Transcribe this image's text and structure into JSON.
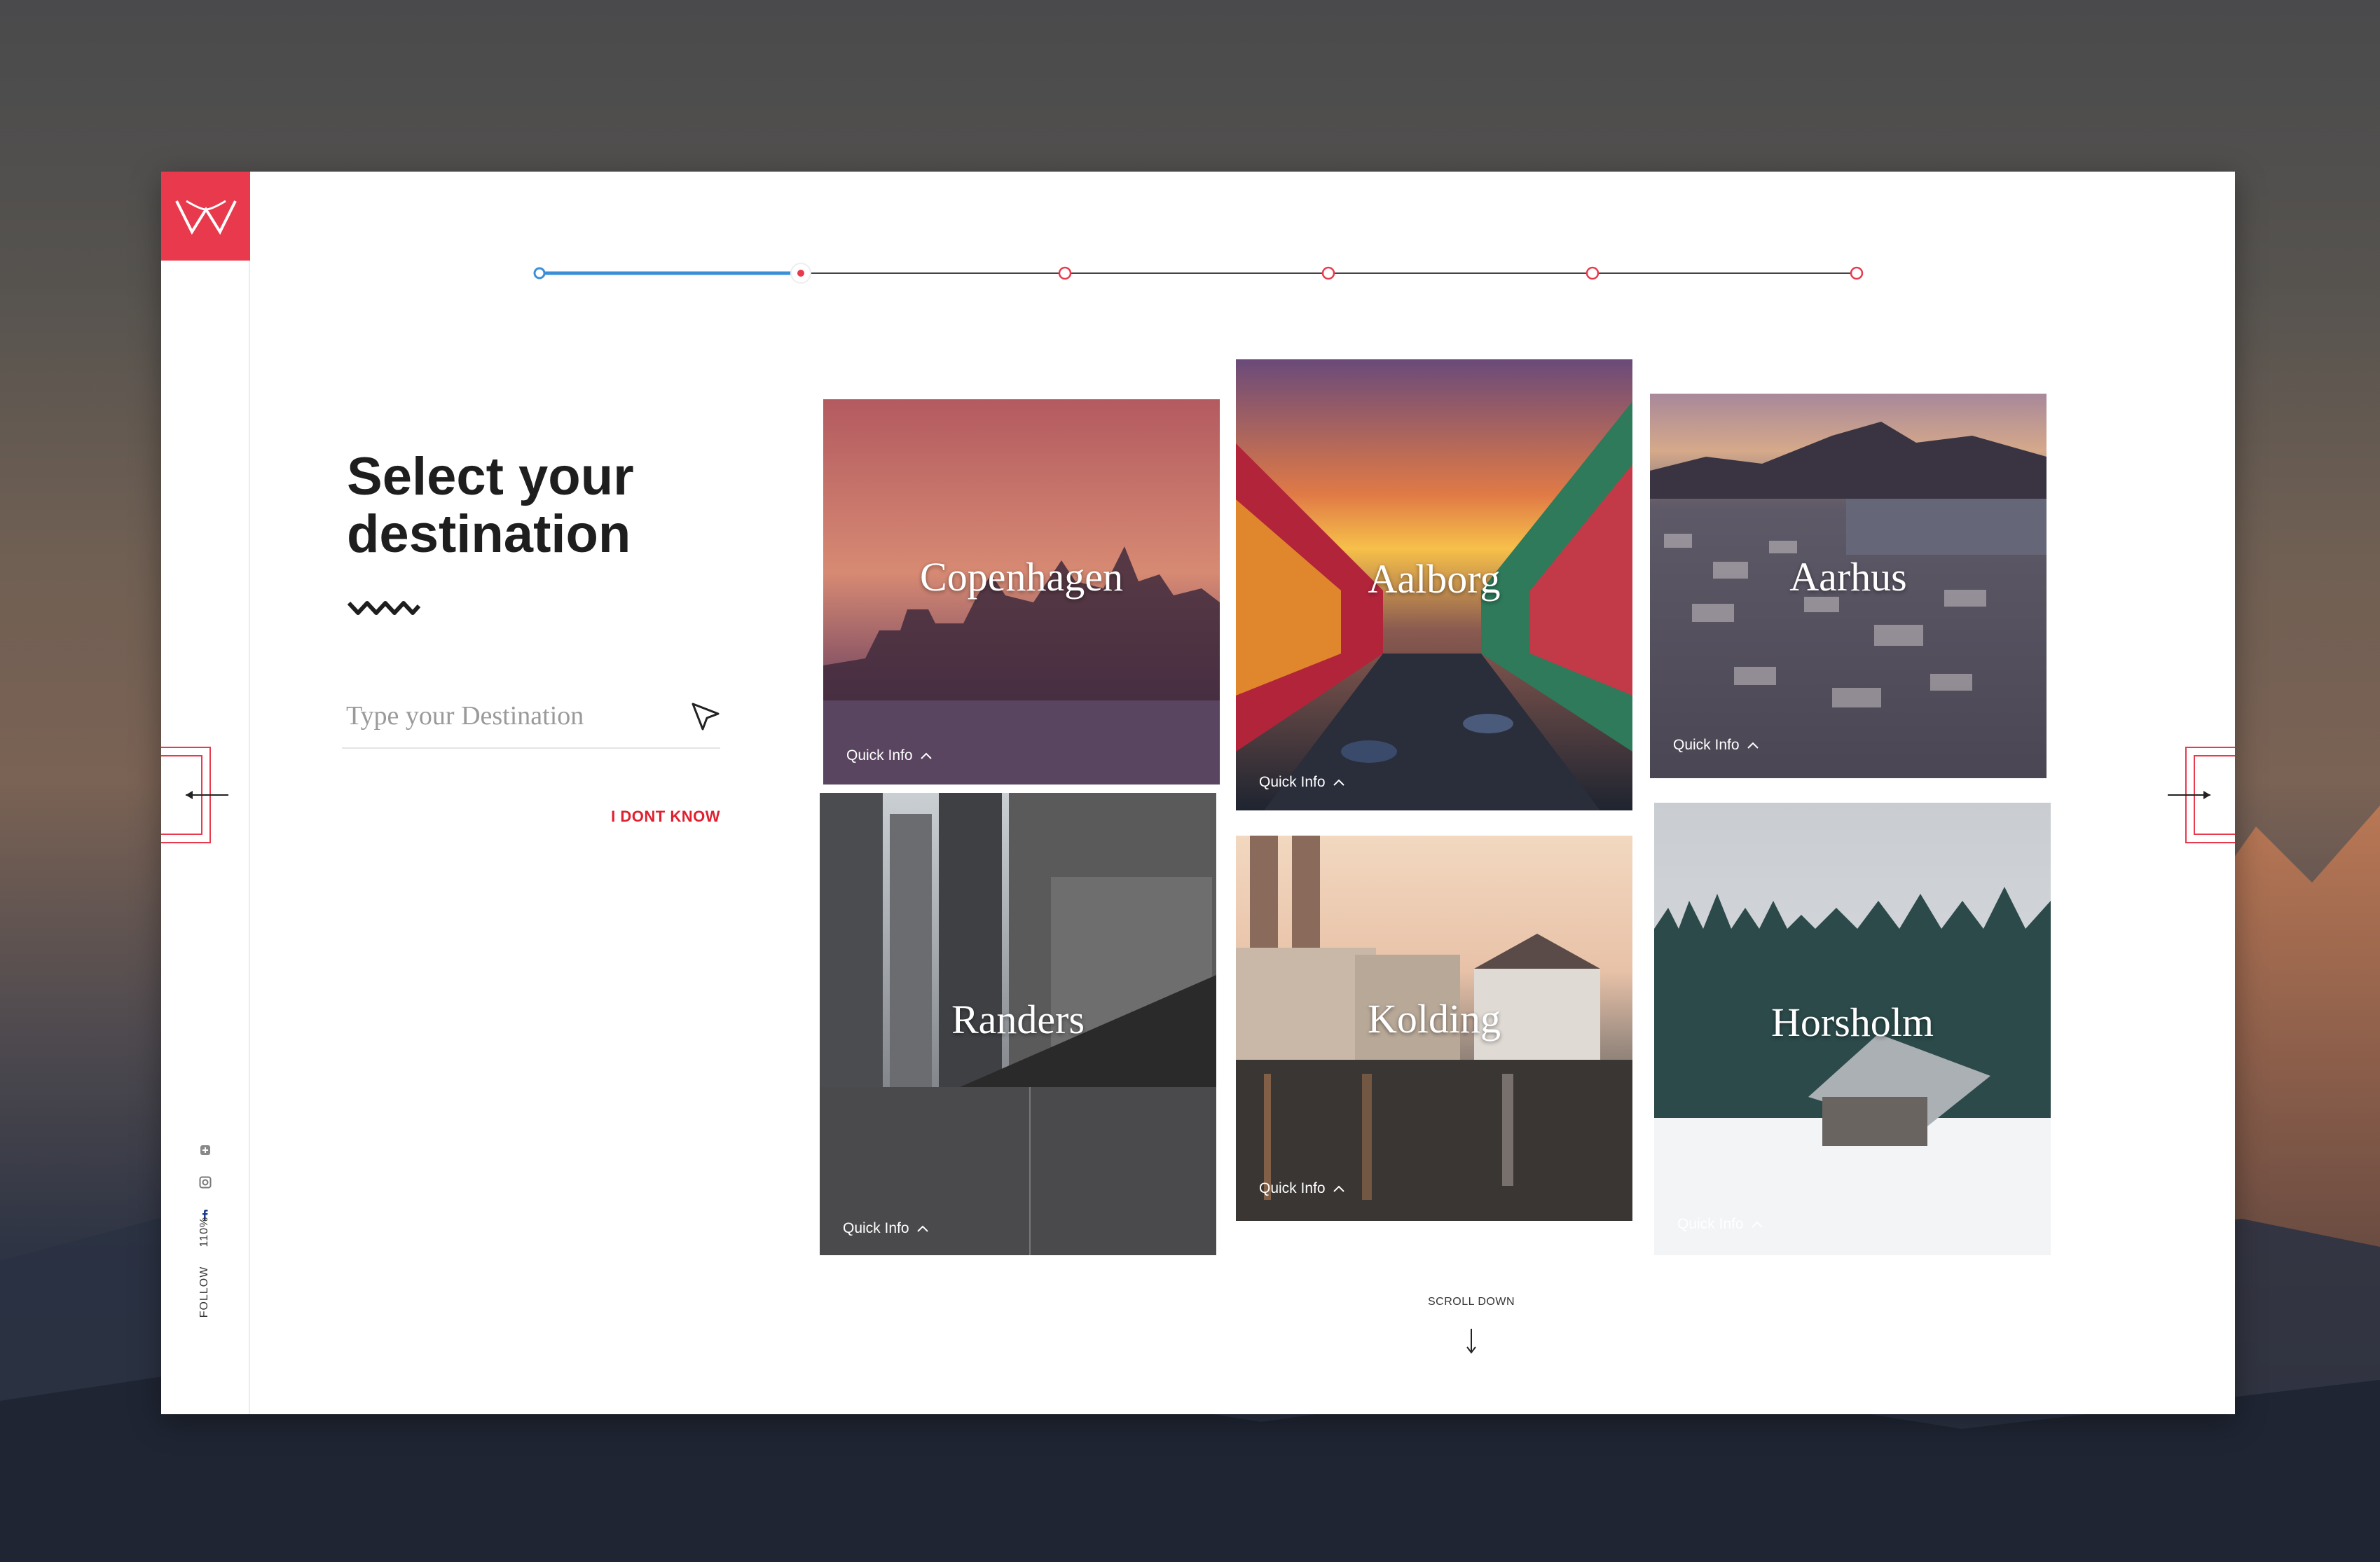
{
  "app": {
    "logo": "W",
    "title": "Select your destination",
    "title_line1": "Select your",
    "title_line2": "destination"
  },
  "colors": {
    "brand": "#e83a4c",
    "progress_done": "#3a8fd6",
    "progress_pending": "#e83a4c",
    "cta": "#e0202f"
  },
  "progress": {
    "steps": 6,
    "current_step": 2
  },
  "search": {
    "placeholder": "Type your Destination",
    "value": "",
    "submit_icon": "cursor-arrow-icon"
  },
  "actions": {
    "dont_know": "I DONT KNOW",
    "scroll_down": "SCROLL DOWN"
  },
  "sidebar": {
    "follow_label": "FOLLOW",
    "zoom": "110%",
    "social": [
      "facebook-icon",
      "instagram-icon",
      "plus-icon"
    ]
  },
  "destinations": [
    {
      "name": "Copenhagen",
      "quick_info": "Quick Info"
    },
    {
      "name": "Aalborg",
      "quick_info": "Quick Info"
    },
    {
      "name": "Aarhus",
      "quick_info": "Quick Info"
    },
    {
      "name": "Randers",
      "quick_info": "Quick Info"
    },
    {
      "name": "Kolding",
      "quick_info": "Quick Info"
    },
    {
      "name": "Horsholm",
      "quick_info": "Quick Info"
    }
  ]
}
